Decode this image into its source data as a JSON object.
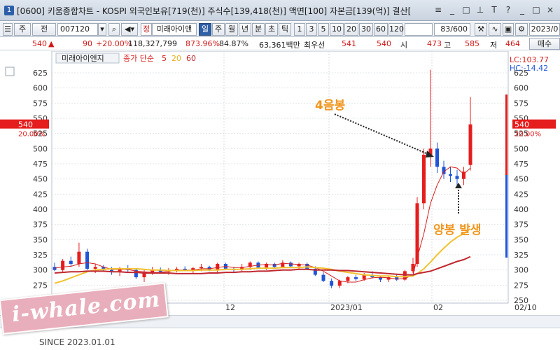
{
  "window": {
    "title": "[0600] 키움종합차트 - KOSPI 외국인보유[719(천)] 주식수[139,418(천)] 액면[100] 자본금[139(억)] 결산[",
    "app_icon": "1",
    "buttons": [
      "≡",
      "_",
      "□",
      "⊥",
      "T",
      "?",
      "_",
      "□",
      "×"
    ]
  },
  "toolbar": {
    "period_labels": [
      "주",
      "전"
    ],
    "code": "007120",
    "stock_badge": "정",
    "stock_name": "미래아이앤",
    "period_tabs": [
      "일",
      "주",
      "월",
      "년",
      "분",
      "초",
      "틱"
    ],
    "active_tab": "일",
    "interval_buttons": [
      "1",
      "3",
      "5",
      "10",
      "20",
      "30",
      "60",
      "120"
    ],
    "page_counter": "83/600",
    "date_field": "2023/0"
  },
  "quote": {
    "price": "540",
    "change_arrow": "▲",
    "change": "90",
    "change_pct": "+20.00%",
    "volume": "118,327,799",
    "pct1": "873.96%",
    "pct2": "84.87%",
    "amount": "63,361백만",
    "best_label": "최우선",
    "best_ask": "541",
    "best_bid": "540",
    "open_label": "시",
    "open": "473",
    "high_label": "고",
    "high": "585",
    "low_label": "저",
    "low": "464",
    "buy_button": "매수"
  },
  "chart_legend": {
    "name": "미래아이앤지",
    "series_label": "종가 단순",
    "ma_periods": [
      "5",
      "20",
      "60"
    ],
    "ma_colors": [
      "#d61f1f",
      "#f2c230",
      "#c0282f"
    ]
  },
  "right_info": {
    "lc": "LC:103.77",
    "hc": "HC:-14.42"
  },
  "price_tag": {
    "price": "540",
    "pct": "20.00%"
  },
  "annotations": {
    "a1": "4음봉",
    "a2": "양봉 발생"
  },
  "x_labels": [
    "12",
    "2023/01",
    "02",
    "02/10"
  ],
  "watermark": {
    "logo": "i-whale.com",
    "since": "SINCE 2023.01.01"
  },
  "chart_data": {
    "type": "line",
    "title": "",
    "ylim": [
      250,
      640
    ],
    "y_ticks": [
      250,
      275,
      300,
      325,
      350,
      375,
      400,
      425,
      450,
      475,
      500,
      525,
      550,
      575,
      600,
      625
    ],
    "candles": [
      [
        305,
        312,
        298,
        300
      ],
      [
        300,
        318,
        296,
        315
      ],
      [
        315,
        322,
        305,
        310
      ],
      [
        310,
        345,
        305,
        330
      ],
      [
        330,
        335,
        300,
        302
      ],
      [
        302,
        310,
        295,
        305
      ],
      [
        305,
        308,
        298,
        300
      ],
      [
        300,
        305,
        292,
        298
      ],
      [
        298,
        305,
        290,
        302
      ],
      [
        302,
        308,
        296,
        300
      ],
      [
        300,
        302,
        285,
        288
      ],
      [
        288,
        300,
        280,
        295
      ],
      [
        295,
        305,
        292,
        300
      ],
      [
        300,
        304,
        294,
        297
      ],
      [
        297,
        303,
        292,
        300
      ],
      [
        300,
        305,
        296,
        302
      ],
      [
        302,
        306,
        298,
        300
      ],
      [
        300,
        305,
        295,
        303
      ],
      [
        303,
        310,
        298,
        305
      ],
      [
        305,
        307,
        298,
        300
      ],
      [
        300,
        312,
        296,
        310
      ],
      [
        310,
        312,
        300,
        302
      ],
      [
        302,
        305,
        296,
        300
      ],
      [
        300,
        310,
        298,
        305
      ],
      [
        305,
        314,
        300,
        312
      ],
      [
        312,
        314,
        302,
        304
      ],
      [
        304,
        312,
        300,
        310
      ],
      [
        310,
        312,
        302,
        305
      ],
      [
        305,
        316,
        303,
        312
      ],
      [
        312,
        314,
        304,
        306
      ],
      [
        306,
        312,
        302,
        310
      ],
      [
        310,
        312,
        300,
        302
      ],
      [
        302,
        306,
        290,
        292
      ],
      [
        292,
        296,
        280,
        282
      ],
      [
        282,
        286,
        270,
        274
      ],
      [
        274,
        284,
        270,
        282
      ],
      [
        282,
        290,
        278,
        288
      ],
      [
        288,
        292,
        282,
        285
      ],
      [
        285,
        295,
        282,
        292
      ],
      [
        292,
        298,
        286,
        288
      ],
      [
        288,
        290,
        280,
        284
      ],
      [
        284,
        290,
        280,
        288
      ],
      [
        288,
        292,
        282,
        284
      ],
      [
        284,
        300,
        282,
        298
      ],
      [
        298,
        320,
        295,
        310
      ],
      [
        310,
        420,
        305,
        410
      ],
      [
        410,
        500,
        400,
        490
      ],
      [
        490,
        630,
        470,
        500
      ],
      [
        500,
        510,
        460,
        470
      ],
      [
        470,
        480,
        450,
        458
      ],
      [
        458,
        470,
        445,
        455
      ],
      [
        455,
        465,
        440,
        450
      ],
      [
        450,
        470,
        440,
        462
      ],
      [
        473,
        585,
        464,
        540
      ]
    ],
    "series": [
      {
        "name": "5",
        "values": [
          303,
          305,
          306,
          310,
          312,
          310,
          305,
          301,
          301,
          301,
          298,
          297,
          296,
          296,
          298,
          300,
          300,
          300,
          302,
          302,
          304,
          306,
          304,
          304,
          306,
          308,
          309,
          308,
          311,
          310,
          309,
          308,
          304,
          298,
          290,
          282,
          280,
          280,
          284,
          287,
          288,
          287,
          285,
          286,
          292,
          320,
          360,
          410,
          440,
          462,
          470,
          468,
          458,
          468
        ]
      },
      {
        "name": "20",
        "values": [
          278,
          282,
          287,
          292,
          297,
          300,
          301,
          302,
          302,
          302,
          302,
          301,
          300,
          300,
          299,
          299,
          299,
          299,
          300,
          300,
          300,
          301,
          301,
          301,
          302,
          303,
          303,
          303,
          304,
          304,
          304,
          305,
          304,
          303,
          301,
          298,
          296,
          294,
          292,
          291,
          290,
          290,
          289,
          289,
          290,
          294,
          302,
          313,
          325,
          336,
          346,
          354,
          360,
          368
        ]
      },
      {
        "name": "60",
        "values": [
          295,
          296,
          297,
          297,
          298,
          298,
          298,
          297,
          297,
          296,
          296,
          295,
          295,
          295,
          295,
          294,
          294,
          294,
          294,
          295,
          295,
          296,
          296,
          297,
          297,
          298,
          298,
          299,
          300,
          300,
          301,
          301,
          300,
          300,
          300,
          299,
          299,
          298,
          297,
          296,
          295,
          294,
          293,
          292,
          292,
          294,
          296,
          298,
          302,
          306,
          310,
          314,
          317,
          322
        ]
      }
    ]
  }
}
